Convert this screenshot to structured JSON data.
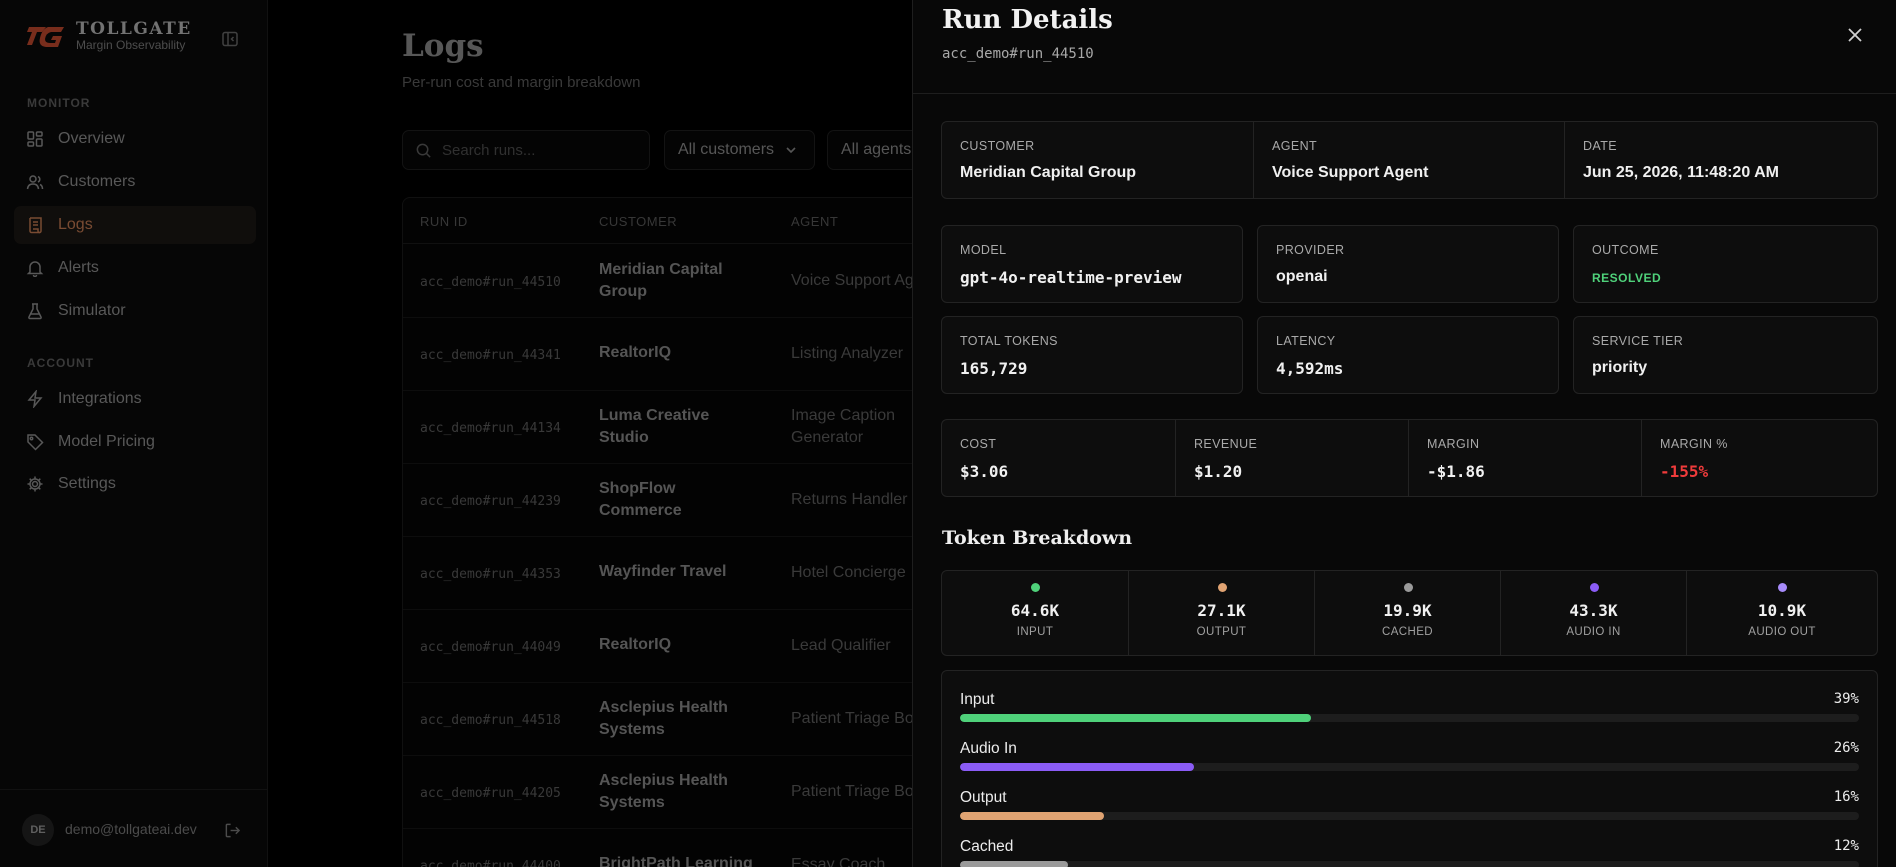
{
  "brand": {
    "name": "TOLLGATE",
    "tagline": "Margin Observability"
  },
  "sidebar": {
    "monitor_label": "MONITOR",
    "monitor_items": [
      {
        "label": "Overview",
        "icon": "grid-icon"
      },
      {
        "label": "Customers",
        "icon": "users-icon"
      },
      {
        "label": "Logs",
        "icon": "scroll-icon",
        "active": true
      },
      {
        "label": "Alerts",
        "icon": "bell-icon"
      },
      {
        "label": "Simulator",
        "icon": "flask-icon"
      }
    ],
    "account_label": "ACCOUNT",
    "account_items": [
      {
        "label": "Integrations",
        "icon": "bolt-icon"
      },
      {
        "label": "Model Pricing",
        "icon": "tag-icon"
      },
      {
        "label": "Settings",
        "icon": "gear-icon"
      }
    ],
    "user": {
      "initials": "DE",
      "email": "demo@tollgateai.dev"
    }
  },
  "main": {
    "title": "Logs",
    "subtitle": "Per-run cost and margin breakdown",
    "search_placeholder": "Search runs...",
    "filters": {
      "customers": "All customers",
      "agents": "All agents"
    },
    "columns": {
      "run_id": "RUN ID",
      "customer": "CUSTOMER",
      "agent": "AGENT"
    },
    "rows": [
      {
        "run_id": "acc_demo#run_44510",
        "customer": "Meridian Capital Group",
        "agent": "Voice Support Ag"
      },
      {
        "run_id": "acc_demo#run_44341",
        "customer": "RealtorIQ",
        "agent": "Listing Analyzer"
      },
      {
        "run_id": "acc_demo#run_44134",
        "customer": "Luma Creative Studio",
        "agent": "Image Caption Generator"
      },
      {
        "run_id": "acc_demo#run_44239",
        "customer": "ShopFlow Commerce",
        "agent": "Returns Handler"
      },
      {
        "run_id": "acc_demo#run_44353",
        "customer": "Wayfinder Travel",
        "agent": "Hotel Concierge"
      },
      {
        "run_id": "acc_demo#run_44049",
        "customer": "RealtorIQ",
        "agent": "Lead Qualifier"
      },
      {
        "run_id": "acc_demo#run_44518",
        "customer": "Asclepius Health Systems",
        "agent": "Patient Triage Bo"
      },
      {
        "run_id": "acc_demo#run_44205",
        "customer": "Asclepius Health Systems",
        "agent": "Patient Triage Bo"
      },
      {
        "run_id": "acc_demo#run_44400",
        "customer": "BrightPath Learning",
        "agent": "Essay Coach"
      }
    ]
  },
  "panel": {
    "title": "Run Details",
    "run_id": "acc_demo#run_44510",
    "customer_label": "CUSTOMER",
    "customer": "Meridian Capital Group",
    "agent_label": "AGENT",
    "agent": "Voice Support Agent",
    "date_label": "DATE",
    "date": "Jun 25, 2026, 11:48:20 AM",
    "model_label": "MODEL",
    "model": "gpt-4o-realtime-preview",
    "provider_label": "PROVIDER",
    "provider": "openai",
    "outcome_label": "OUTCOME",
    "outcome": "RESOLVED",
    "tokens_label": "TOTAL TOKENS",
    "tokens": "165,729",
    "latency_label": "LATENCY",
    "latency": "4,592ms",
    "tier_label": "SERVICE TIER",
    "tier": "priority",
    "cost_label": "COST",
    "cost": "$3.06",
    "revenue_label": "REVENUE",
    "revenue": "$1.20",
    "margin_label": "MARGIN",
    "margin": "-$1.86",
    "margin_pct_label": "MARGIN %",
    "margin_pct": "-155%",
    "breakdown_title": "Token Breakdown",
    "token_types": [
      {
        "label": "INPUT",
        "value": "64.6K",
        "color": "#4fd17a"
      },
      {
        "label": "OUTPUT",
        "value": "27.1K",
        "color": "#e0a372"
      },
      {
        "label": "CACHED",
        "value": "19.9K",
        "color": "#9a9a9a"
      },
      {
        "label": "AUDIO IN",
        "value": "43.3K",
        "color": "#8b5cf6"
      },
      {
        "label": "AUDIO OUT",
        "value": "10.9K",
        "color": "#a78bfa"
      }
    ],
    "bars": [
      {
        "label": "Input",
        "pct": "39%",
        "fraction": 0.39,
        "color": "#4fd17a"
      },
      {
        "label": "Audio In",
        "pct": "26%",
        "fraction": 0.26,
        "color": "#8b5cf6"
      },
      {
        "label": "Output",
        "pct": "16%",
        "fraction": 0.16,
        "color": "#e0a372"
      },
      {
        "label": "Cached",
        "pct": "12%",
        "fraction": 0.12,
        "color": "#9a9a9a"
      }
    ]
  }
}
